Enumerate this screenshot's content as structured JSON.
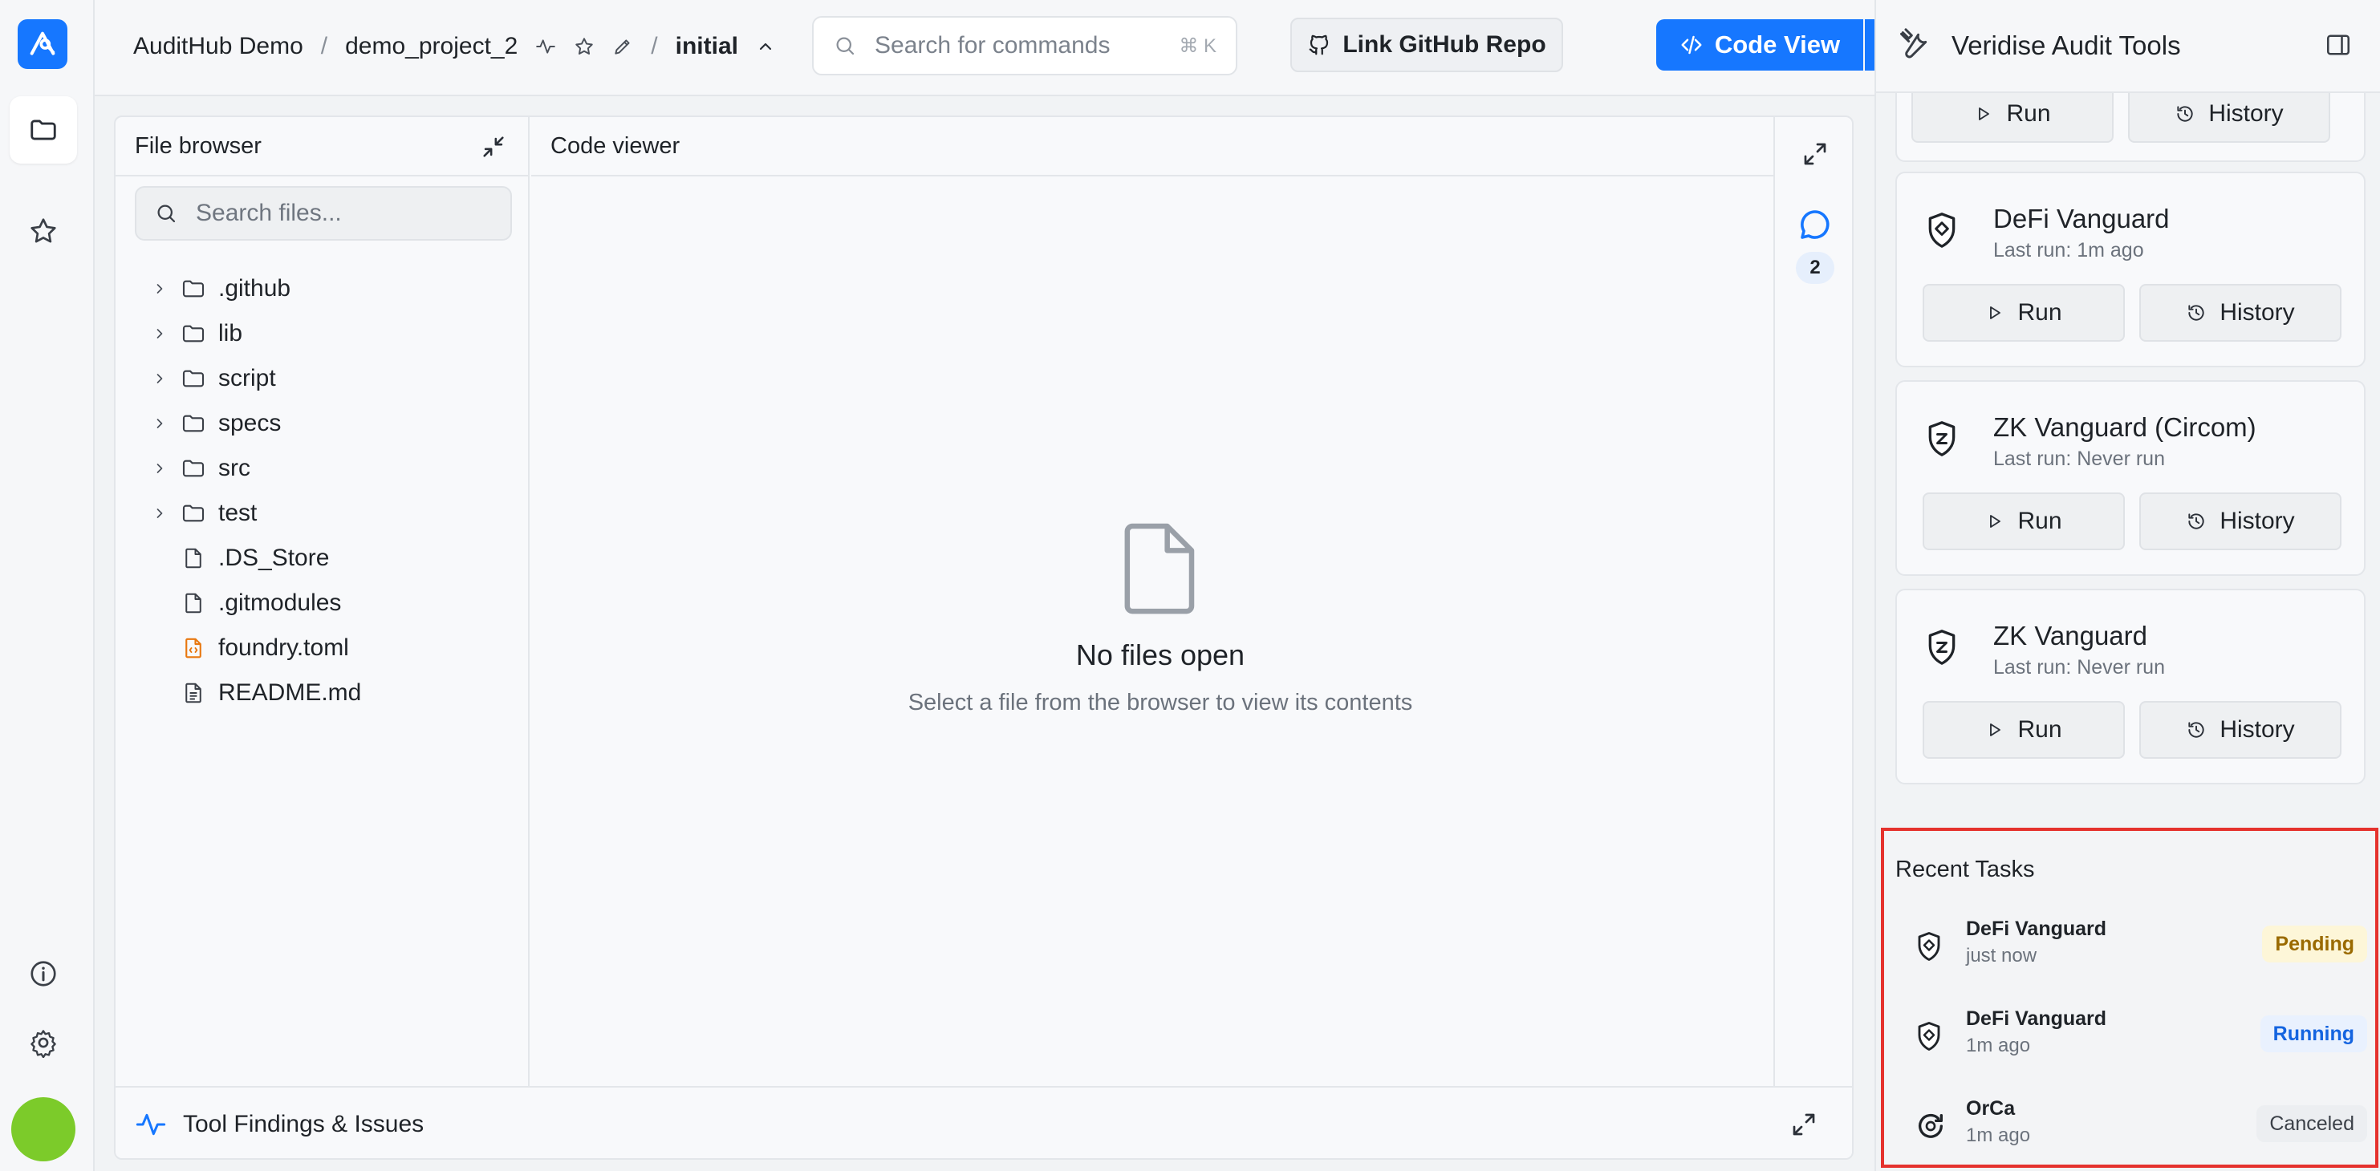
{
  "breadcrumb": {
    "org": "AuditHub Demo",
    "sep1": "/",
    "project": "demo_project_2",
    "sep2": "/",
    "version": "initial"
  },
  "command_search": {
    "placeholder": "Search for commands",
    "shortcut": "⌘ K"
  },
  "header_buttons": {
    "github": "Link GitHub Repo",
    "code_view": "Code View"
  },
  "file_browser": {
    "title": "File browser",
    "search_placeholder": "Search files...",
    "items": [
      {
        "name": ".github",
        "type": "folder"
      },
      {
        "name": "lib",
        "type": "folder"
      },
      {
        "name": "script",
        "type": "folder"
      },
      {
        "name": "specs",
        "type": "folder"
      },
      {
        "name": "src",
        "type": "folder"
      },
      {
        "name": "test",
        "type": "folder"
      },
      {
        "name": ".DS_Store",
        "type": "file"
      },
      {
        "name": ".gitmodules",
        "type": "file"
      },
      {
        "name": "foundry.toml",
        "type": "config"
      },
      {
        "name": "README.md",
        "type": "doc"
      }
    ]
  },
  "code_viewer": {
    "title": "Code viewer",
    "empty_title": "No files open",
    "empty_subtitle": "Select a file from the browser to view its contents"
  },
  "comments": {
    "count": "2"
  },
  "findings": {
    "label": "Tool Findings & Issues"
  },
  "audit_tools": {
    "title": "Veridise Audit Tools",
    "run_label": "Run",
    "history_label": "History",
    "tools": [
      {
        "name": "DeFi Vanguard",
        "last_run": "Last run: 1m ago"
      },
      {
        "name": "ZK Vanguard (Circom)",
        "last_run": "Last run: Never run"
      },
      {
        "name": "ZK Vanguard",
        "last_run": "Last run: Never run"
      }
    ]
  },
  "recent_tasks": {
    "title": "Recent Tasks",
    "tasks": [
      {
        "name": "DeFi Vanguard",
        "time": "just now",
        "status": "Pending"
      },
      {
        "name": "DeFi Vanguard",
        "time": "1m ago",
        "status": "Running"
      },
      {
        "name": "OrCa",
        "time": "1m ago",
        "status": "Canceled"
      }
    ]
  },
  "colors": {
    "accent": "#1677ff",
    "pending_bg": "#fdf6d8",
    "pending_text": "#9a6a00",
    "running_bg": "#e9f1fe",
    "running_text": "#1464e0",
    "canceled_bg": "#eceef1",
    "canceled_text": "#3b4048",
    "highlight_border": "#e5322d",
    "avatar": "#7ccb2a"
  }
}
